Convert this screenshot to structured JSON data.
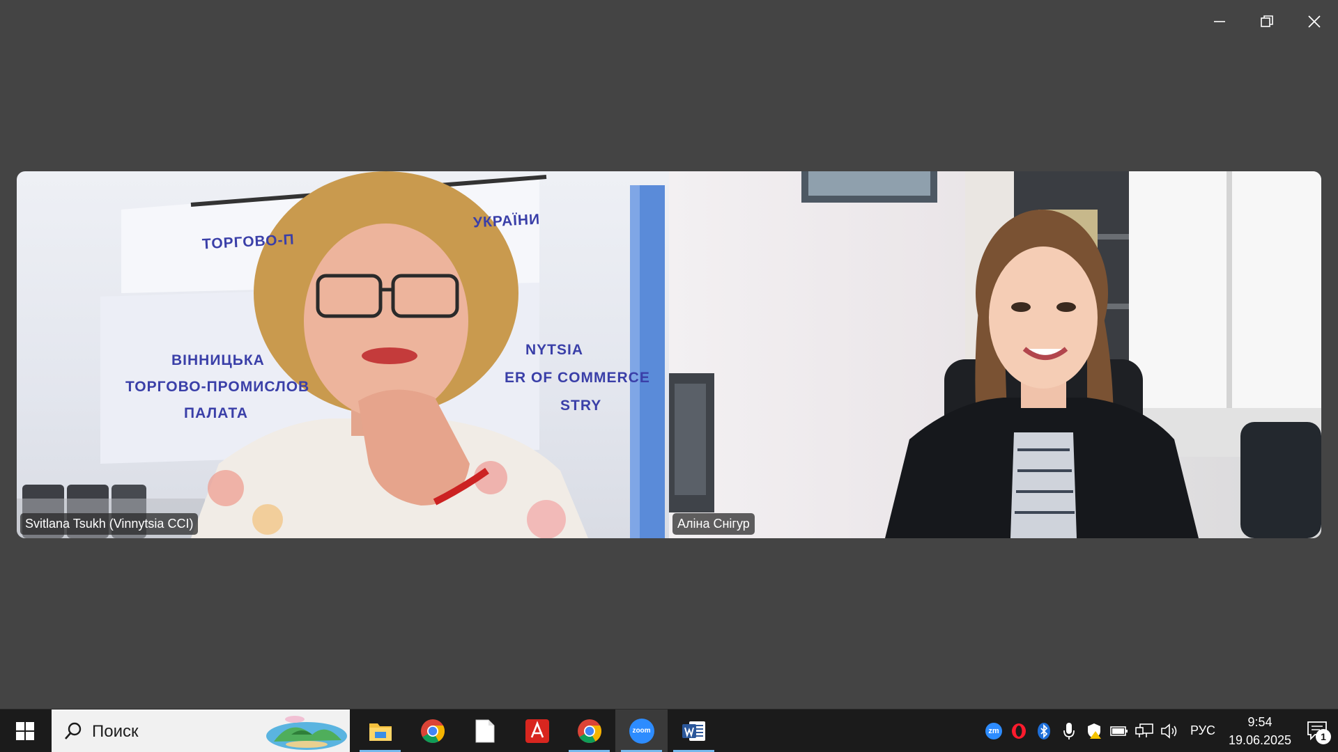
{
  "window": {
    "minimize_icon": "minimize-icon",
    "restore_icon": "restore-icon",
    "close_icon": "close-icon"
  },
  "participants": [
    {
      "name": "Svitlana Tsukh (Vinnytsia CCI)",
      "background_sign": {
        "top_left": "ТОРГОВО-П",
        "top_right": "УКРАЇНИ",
        "left_line1": "ВІННИЦЬКА",
        "left_line2": "ТОРГОВО-ПРОМИСЛОВ",
        "left_line3": "ПАЛАТА",
        "right_line1": "NYTSIA",
        "right_line2": "ER OF COMMERCE",
        "right_line3": "STRY"
      }
    },
    {
      "name": "Аліна Снігур"
    }
  ],
  "taskbar": {
    "search_placeholder": "Поиск",
    "apps": [
      {
        "name": "file-explorer",
        "active": false
      },
      {
        "name": "chrome",
        "active": false
      },
      {
        "name": "notepad-file",
        "active": false
      },
      {
        "name": "acrobat-reader",
        "active": false
      },
      {
        "name": "chrome",
        "active": false
      },
      {
        "name": "zoom",
        "active": true
      },
      {
        "name": "word",
        "active": false
      }
    ],
    "zoom_label": "zoom",
    "tray": {
      "zoom_tray_label": "zm",
      "language": "РУС",
      "time": "9:54",
      "date": "19.06.2025",
      "notification_count": "1"
    }
  },
  "colors": {
    "background": "#444444",
    "taskbar": "#1b1b1b",
    "active_underline": "#76b9ed",
    "zoom_blue": "#2d8cff"
  }
}
